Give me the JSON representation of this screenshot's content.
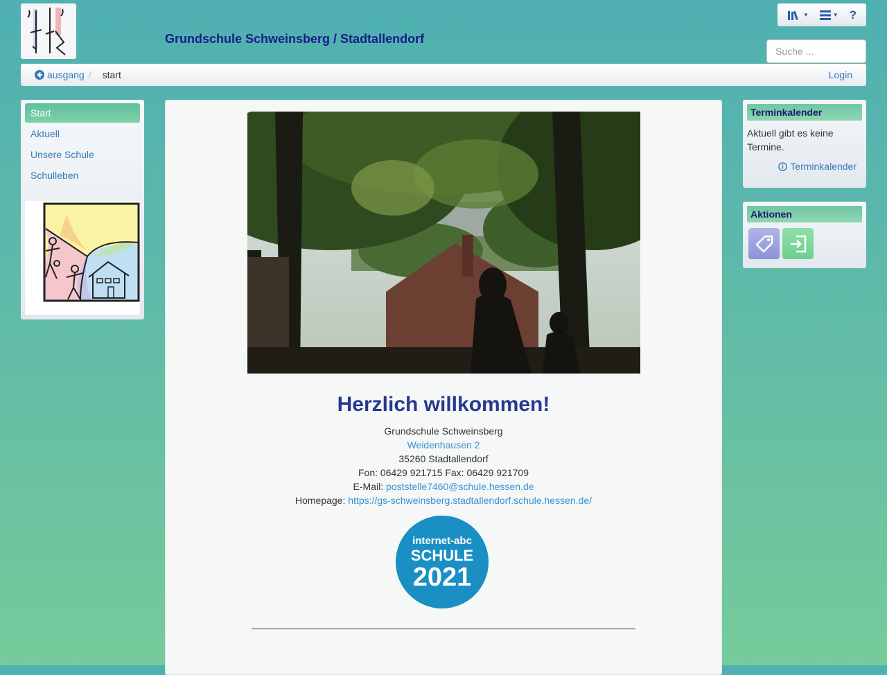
{
  "header": {
    "site_title": "Grundschule Schweinsberg / Stadtallendorf",
    "search_placeholder": "Suche ..."
  },
  "toolbar": {
    "icons": [
      "books-icon",
      "menu-icon",
      "help-icon"
    ]
  },
  "breadcrumb": {
    "back_label": "ausgang",
    "current": "start",
    "login_label": "Login"
  },
  "nav": {
    "items": [
      {
        "label": "Start",
        "active": true
      },
      {
        "label": "Aktuell",
        "active": false
      },
      {
        "label": "Unsere Schule",
        "active": false
      },
      {
        "label": "Schulleben",
        "active": false
      }
    ]
  },
  "main": {
    "heading": "Herzlich willkommen!",
    "school": "Grundschule Schweinsberg",
    "street": "Weidenhausen 2",
    "city": "35260 Stadtallendorf",
    "phone_line": "Fon: 06429 921715 Fax: 06429 921709",
    "email_label": "E-Mail:",
    "email": "poststelle7460@schule.hessen.de",
    "homepage_label": "Homepage:",
    "homepage": "https://gs-schweinsberg.stadtallendorf.schule.hessen.de/",
    "badge": {
      "line1": "internet-abc",
      "line2": "SCHULE",
      "line3": "2021"
    }
  },
  "calendar": {
    "title": "Terminkalender",
    "text": "Aktuell gibt es keine Termine.",
    "link": "Terminkalender"
  },
  "actions": {
    "title": "Aktionen"
  },
  "colors": {
    "title": "#1a1a8a",
    "heading": "#263890",
    "link": "#337ab7",
    "badge": "#1a8fc4"
  }
}
